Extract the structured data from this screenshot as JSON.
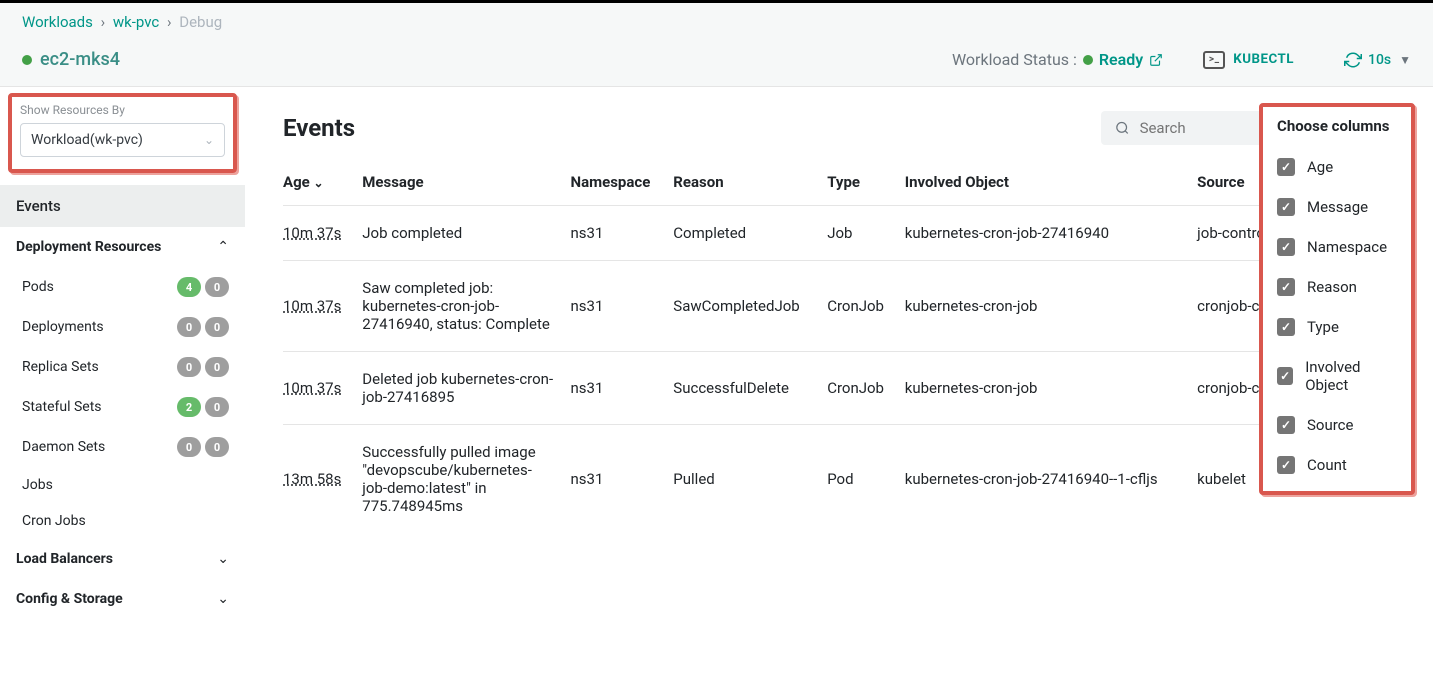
{
  "breadcrumb": {
    "l1": "Workloads",
    "l2": "wk-pvc",
    "l3": "Debug"
  },
  "context": {
    "name": "ec2-mks4"
  },
  "workload_status": {
    "label": "Workload Status :",
    "value": "Ready"
  },
  "kubectl_label": "KUBECTL",
  "refresh_interval": "10s",
  "filter": {
    "label": "Show Resources By",
    "value": "Workload(wk-pvc)"
  },
  "sidebar": {
    "events": "Events",
    "deployment_resources": "Deployment Resources",
    "subs": [
      {
        "label": "Pods",
        "green": "4",
        "grey": "0"
      },
      {
        "label": "Deployments",
        "green": "0",
        "grey": "0",
        "green_is_grey": true
      },
      {
        "label": "Replica Sets",
        "green": "0",
        "grey": "0",
        "green_is_grey": true
      },
      {
        "label": "Stateful Sets",
        "green": "2",
        "grey": "0"
      },
      {
        "label": "Daemon Sets",
        "green": "0",
        "grey": "0",
        "green_is_grey": true
      },
      {
        "label": "Jobs"
      },
      {
        "label": "Cron Jobs"
      }
    ],
    "load_balancers": "Load Balancers",
    "config_storage": "Config & Storage"
  },
  "page_title": "Events",
  "search_placeholder": "Search",
  "columns": [
    "Age",
    "Message",
    "Namespace",
    "Reason",
    "Type",
    "Involved Object",
    "Source",
    "Count"
  ],
  "rows": [
    {
      "age": "10m 37s",
      "message": "Job completed",
      "ns": "ns31",
      "reason": "Completed",
      "type": "Job",
      "obj": "kubernetes-cron-job-27416940",
      "source": "job-controller",
      "count": ""
    },
    {
      "age": "10m 37s",
      "message": "Saw completed job: kubernetes-cron-job-27416940, status: Complete",
      "ns": "ns31",
      "reason": "SawCompletedJob",
      "type": "CronJob",
      "obj": "kubernetes-cron-job",
      "source": "cronjob-controller",
      "count": ""
    },
    {
      "age": "10m 37s",
      "message": "Deleted job kubernetes-cron-job-27416895",
      "ns": "ns31",
      "reason": "SuccessfulDelete",
      "type": "CronJob",
      "obj": "kubernetes-cron-job",
      "source": "cronjob-controller",
      "count": ""
    },
    {
      "age": "13m 58s",
      "message": "Successfully pulled image \"devopscube/kubernetes-job-demo:latest\" in 775.748945ms",
      "ns": "ns31",
      "reason": "Pulled",
      "type": "Pod",
      "obj": "kubernetes-cron-job-27416940--1-cfljs",
      "source": "kubelet",
      "count": ""
    }
  ],
  "columns_panel": {
    "title": "Choose columns",
    "items": [
      "Age",
      "Message",
      "Namespace",
      "Reason",
      "Type",
      "Involved Object",
      "Source",
      "Count"
    ]
  }
}
